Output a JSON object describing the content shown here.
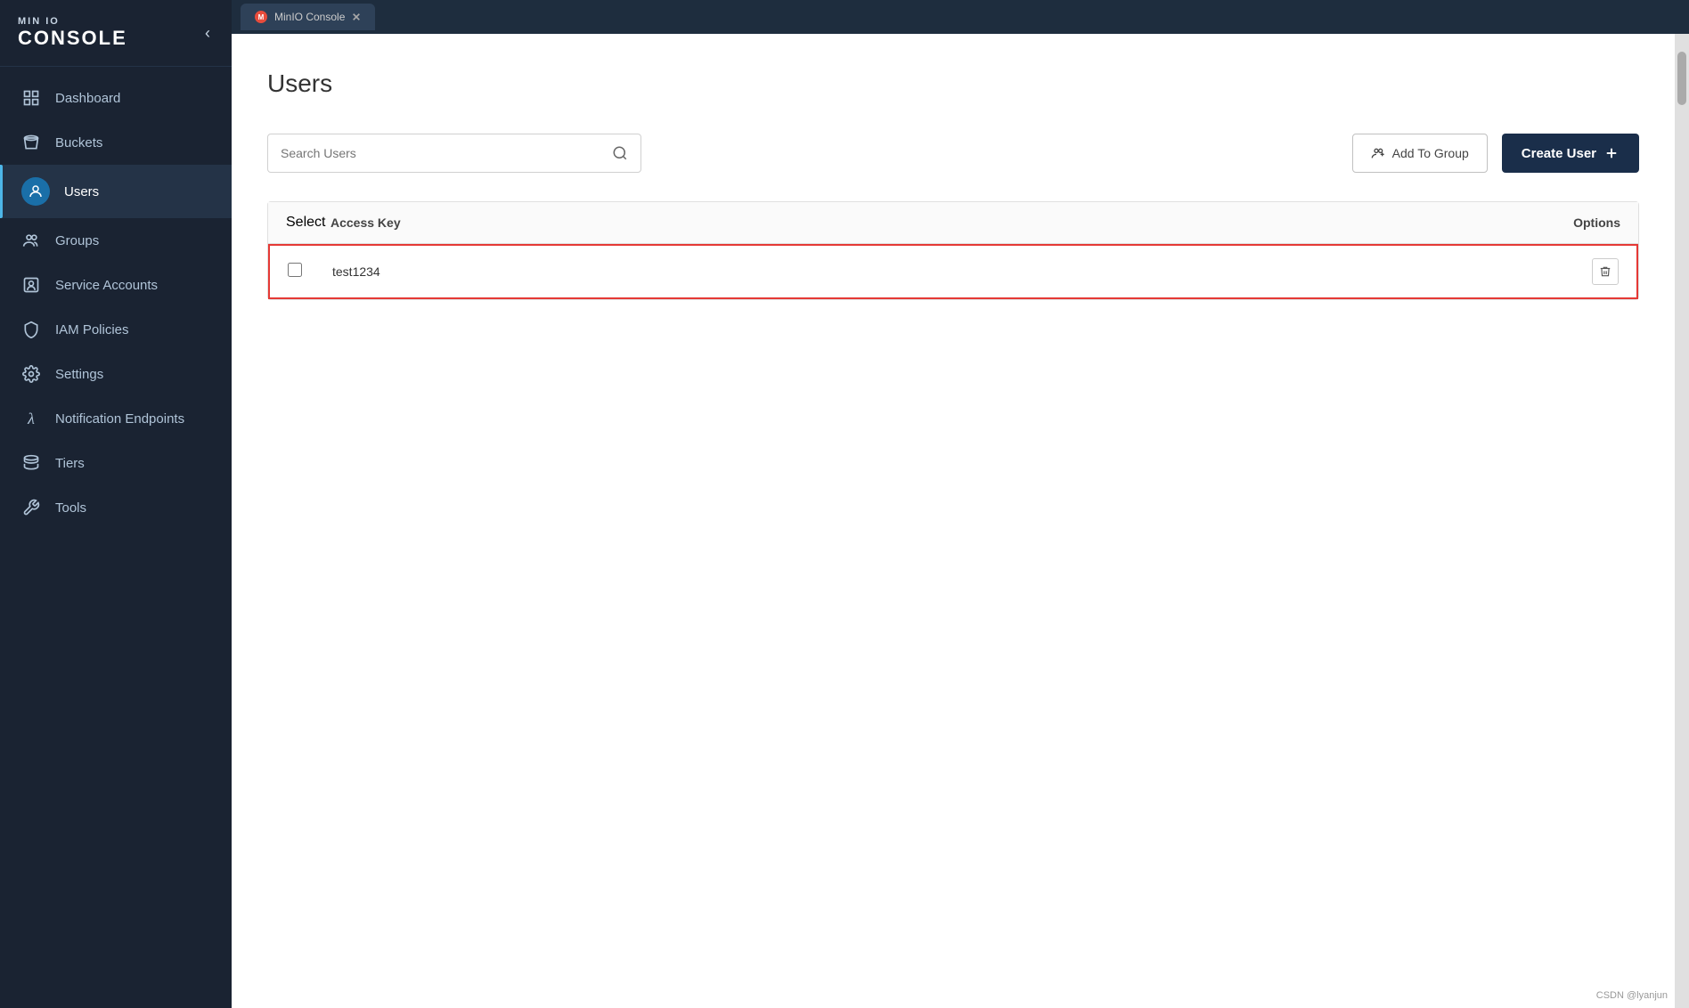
{
  "browser": {
    "tab_label": "MinIO Console",
    "tab_favicon": "M"
  },
  "sidebar": {
    "logo_top": "MIN IO",
    "logo_bottom": "CONSOLE",
    "collapse_icon": "‹",
    "items": [
      {
        "id": "dashboard",
        "label": "Dashboard",
        "icon": "⊞",
        "active": false
      },
      {
        "id": "buckets",
        "label": "Buckets",
        "icon": "☰",
        "active": false
      },
      {
        "id": "users",
        "label": "Users",
        "icon": "👤",
        "active": true
      },
      {
        "id": "groups",
        "label": "Groups",
        "icon": "👥",
        "active": false
      },
      {
        "id": "service-accounts",
        "label": "Service Accounts",
        "icon": "⊡",
        "active": false
      },
      {
        "id": "iam-policies",
        "label": "IAM Policies",
        "icon": "🛡",
        "active": false
      },
      {
        "id": "settings",
        "label": "Settings",
        "icon": "⚙",
        "active": false
      },
      {
        "id": "notification-endpoints",
        "label": "Notification Endpoints",
        "icon": "λ",
        "active": false
      },
      {
        "id": "tiers",
        "label": "Tiers",
        "icon": "◈",
        "active": false
      },
      {
        "id": "tools",
        "label": "Tools",
        "icon": "✂",
        "active": false
      }
    ]
  },
  "page": {
    "title": "Users"
  },
  "toolbar": {
    "search_placeholder": "Search Users",
    "search_value": "",
    "add_to_group_label": "Add To Group",
    "create_user_label": "Create User"
  },
  "table": {
    "col_select": "Select",
    "col_access_key": "Access Key",
    "col_options": "Options",
    "rows": [
      {
        "access_key": "test1234",
        "selected": false
      }
    ]
  },
  "watermark": "CSDN @lyanjun"
}
